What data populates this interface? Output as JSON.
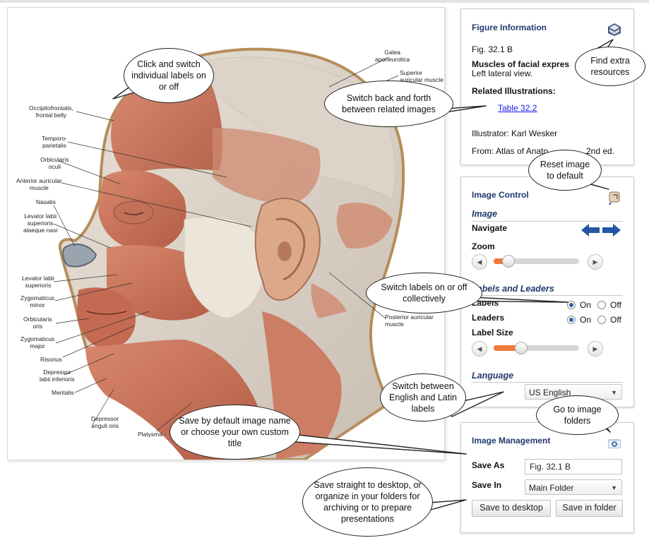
{
  "figure_labels": {
    "galea": "Galea\naponeurotica",
    "superior_auricular": "Superior\nauricular muscle",
    "occipitofrontalis": "Occipitofrontalis,\nfrontal belly",
    "temporoparietalis": "Temporo-\nparietalis",
    "orbicularis_oculi": "Orbicularis\noculi",
    "anterior_auricular": "Anterior auricular\nmuscle",
    "nasalis": "Nasalis",
    "levator_alaeque": "Levator labii\nsuperioris\nalaeque nasi",
    "levator_superioris": "Levator labii\nsuperioris",
    "zygomaticus_minor": "Zygomaticus\nminor",
    "orbicularis_oris": "Orbicularis\noris",
    "zygomaticus_major": "Zygomaticus\nmajor",
    "risorius": "Risorius",
    "depressor_labii": "Depressor\nlabii inferioris",
    "mentalis": "Mentalis",
    "depressor_anguli": "Depressor\nanguli oris",
    "platysma": "Platysma",
    "posterior_auricular": "Posterior auricular\nmuscle"
  },
  "figure_info": {
    "title": "Figure Information",
    "icon": "book-icon",
    "fig_number": "Fig. 32.1 B",
    "caption_title": "Muscles of facial expres",
    "caption_sub": "Left lateral view.",
    "related_heading": "Related Illustrations:",
    "related_link": "Table 32.2",
    "illustrator": "Illustrator: Karl Wesker",
    "source": "From: Atlas of Anato",
    "source_tail": "2nd ed."
  },
  "image_control": {
    "title": "Image Control",
    "reset_icon": "reset-hand-icon",
    "image_section": "Image",
    "navigate_label": "Navigate",
    "zoom_label": "Zoom",
    "zoom_level": 0.1,
    "labels_section": "Labels and Leaders",
    "labels_label": "Labels",
    "leaders_label": "Leaders",
    "on_label": "On",
    "off_label": "Off",
    "labels_value": "On",
    "leaders_value": "On",
    "label_size_label": "Label Size",
    "label_size_level": 0.25,
    "language_section": "Language",
    "language_value": "US English"
  },
  "image_management": {
    "title": "Image Management",
    "folder_icon": "gear-folder-icon",
    "save_as_label": "Save As",
    "save_as_value": "Fig. 32.1 B",
    "save_in_label": "Save In",
    "save_in_value": "Main Folder",
    "save_desktop_button": "Save to desktop",
    "save_folder_button": "Save in folder"
  },
  "callouts": {
    "individual_labels": "Click and switch individual labels on or off",
    "related_images": "Switch back and forth between related images",
    "extra_resources": "Find extra resources",
    "reset_image": "Reset image to default",
    "labels_collective": "Switch labels on or off collectively",
    "language_switch": "Switch between English and Latin labels",
    "image_folders": "Go to image folders",
    "save_title": "Save by default image name or choose your own custom title",
    "save_desktop": "Save straight to desktop, or organize in your folders for archiving or to prepare presentations"
  },
  "colors": {
    "accent": "#1f3a6e",
    "slider_fill": "#f07a3c",
    "muscle": "#c8735a",
    "link": "#1a1aee"
  }
}
